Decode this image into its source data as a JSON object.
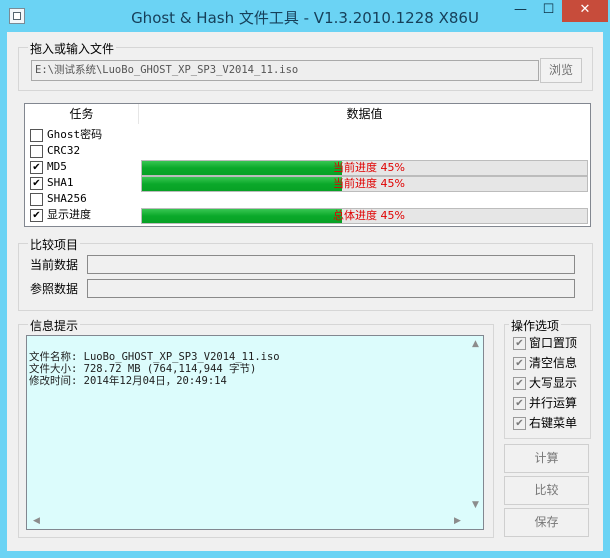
{
  "window": {
    "title": "Ghost & Hash 文件工具 - V1.3.2010.1228 X86U",
    "minimize_glyph": "—",
    "maximize_glyph": "☐",
    "close_glyph": "✕"
  },
  "drop_group": {
    "title": "拖入或输入文件",
    "path_value": "E:\\测试系统\\LuoBo_GHOST_XP_SP3_V2014_11.iso",
    "browse_label": "浏览"
  },
  "task_table": {
    "headers": {
      "task": "任务",
      "value": "数据值"
    },
    "rows": [
      {
        "label": "Ghost密码",
        "checked": false
      },
      {
        "label": "CRC32",
        "checked": false
      },
      {
        "label": "MD5",
        "checked": true,
        "progress_text": "当前进度 45%",
        "progress": 0.45
      },
      {
        "label": "SHA1",
        "checked": true,
        "progress_text": "当前进度 45%",
        "progress": 0.45
      },
      {
        "label": "SHA256",
        "checked": false
      },
      {
        "label": "显示进度",
        "checked": true,
        "progress_text": "总体进度 45%",
        "progress": 0.45
      }
    ]
  },
  "compare_group": {
    "title": "比较项目",
    "current_label": "当前数据",
    "current_value": "",
    "reference_label": "参照数据",
    "reference_value": ""
  },
  "info_group": {
    "title": "信息提示",
    "lines": [
      "文件名称: LuoBo_GHOST_XP_SP3_V2014_11.iso",
      "文件大小: 728.72 MB (764,114,944 字节)",
      "修改时间: 2014年12月04日，20:49:14"
    ]
  },
  "options_group": {
    "title": "操作选项",
    "items": [
      {
        "label": "窗口置顶",
        "checked": true
      },
      {
        "label": "清空信息",
        "checked": true
      },
      {
        "label": "大写显示",
        "checked": true
      },
      {
        "label": "并行运算",
        "checked": true
      },
      {
        "label": "右键菜单",
        "checked": true
      }
    ]
  },
  "buttons": {
    "compute": "计算",
    "compare": "比较",
    "save": "保存"
  },
  "colors": {
    "title_bar": "#6bd3f4",
    "close_button": "#c74c3b",
    "progress_fill": "#0ba92a",
    "progress_text": "#e00000",
    "info_background": "#dcfcfc"
  }
}
